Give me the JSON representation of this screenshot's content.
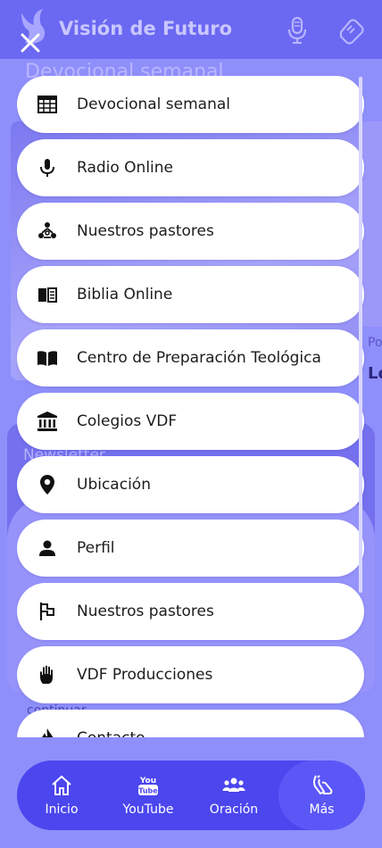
{
  "app": {
    "title": "Visión de Futuro"
  },
  "background": {
    "section_title": "Devocional semanal",
    "fragment_1": "Po",
    "fragment_2": "Lo",
    "newsletter_title": "Newsletter",
    "continuar": "continuar"
  },
  "menu": {
    "items": [
      {
        "label": "Devocional semanal",
        "icon": "calendar-table-icon"
      },
      {
        "label": "Radio Online",
        "icon": "microphone-icon"
      },
      {
        "label": "Nuestros pastores",
        "icon": "people-network-icon"
      },
      {
        "label": "Biblia Online",
        "icon": "book-open-icon"
      },
      {
        "label": "Centro de Preparación Teológica",
        "icon": "open-book-icon"
      },
      {
        "label": "Colegios VDF",
        "icon": "institution-icon"
      },
      {
        "label": "Ubicación",
        "icon": "location-pin-icon"
      },
      {
        "label": "Perfil",
        "icon": "person-icon"
      },
      {
        "label": "Nuestros pastores",
        "icon": "flag-icon"
      },
      {
        "label": "VDF Producciones",
        "icon": "hand-icon"
      },
      {
        "label": "Contacto",
        "icon": "flame-icon"
      }
    ]
  },
  "bottom_nav": {
    "items": [
      {
        "label": "Inicio",
        "icon": "home-icon"
      },
      {
        "label": "YouTube",
        "icon": "youtube-icon"
      },
      {
        "label": "Oración",
        "icon": "group-icon"
      },
      {
        "label": "Más",
        "icon": "praying-hands-icon",
        "active": true
      }
    ]
  },
  "colors": {
    "primary": "#4b46ee",
    "appbar": "#6b68f2",
    "overlay": "#8f8ffb",
    "menu_item_bg": "#ffffff",
    "menu_text": "#1c1c1c"
  }
}
